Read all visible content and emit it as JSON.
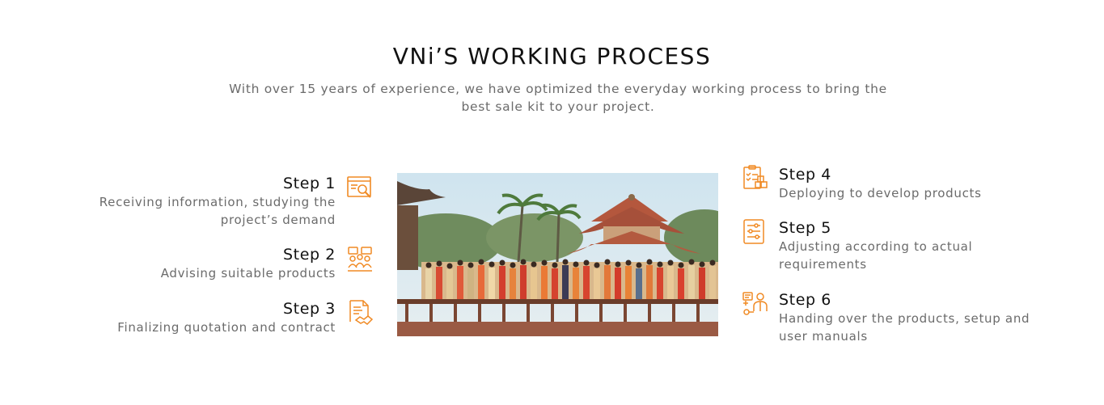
{
  "header": {
    "title": "VNi’S WORKING PROCESS",
    "subtitle": "With over 15 years of experience, we have optimized the everyday working process to bring the best sale kit to your project."
  },
  "steps": [
    {
      "title": "Step 1",
      "desc": "Receiving information, studying the project’s demand",
      "icon": "search-document-icon"
    },
    {
      "title": "Step 2",
      "desc": "Advising suitable products",
      "icon": "team-consult-icon"
    },
    {
      "title": "Step 3",
      "desc": "Finalizing quotation and contract",
      "icon": "contract-handshake-icon"
    },
    {
      "title": "Step 4",
      "desc": "Deploying to develop products",
      "icon": "checklist-boxes-icon"
    },
    {
      "title": "Step 5",
      "desc": "Adjusting according to actual requirements",
      "icon": "adjust-sliders-icon"
    },
    {
      "title": "Step 6",
      "desc": "Handing over the products, setup and user manuals",
      "icon": "handover-person-icon"
    }
  ],
  "colors": {
    "accent": "#f08a24",
    "heading": "#111111",
    "body_text": "#6b6b6b"
  }
}
